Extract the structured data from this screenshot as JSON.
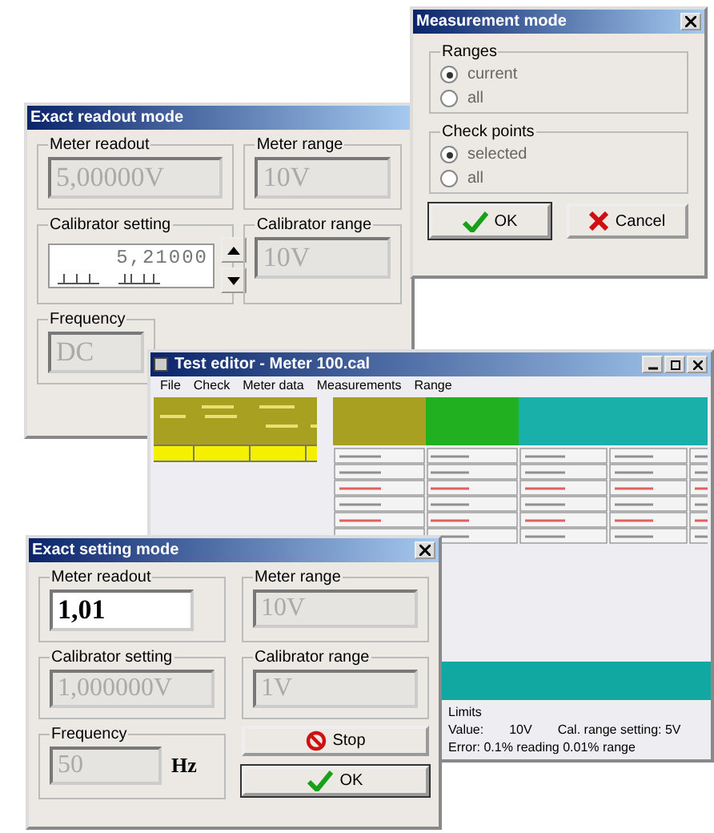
{
  "readout_dialog": {
    "title": "Exact readout mode",
    "meter_readout": {
      "label": "Meter readout",
      "value": "5,00000V"
    },
    "meter_range": {
      "label": "Meter range",
      "value": "10V"
    },
    "calibrator_setting": {
      "label": "Calibrator setting",
      "value": "5,21000"
    },
    "calibrator_range": {
      "label": "Calibrator range",
      "value": "10V"
    },
    "frequency": {
      "label": "Frequency",
      "value": "DC"
    }
  },
  "editor_window": {
    "title": "Test editor - Meter 100.cal",
    "menu": [
      "File",
      "Check",
      "Meter data",
      "Measurements",
      "Range"
    ],
    "status": {
      "heading": "Limits",
      "value_label": "Value:",
      "value": "10V",
      "range_setting": "Cal. range setting: 5V",
      "error": "Error: 0.1% reading  0.01% range"
    }
  },
  "measurement_dialog": {
    "title": "Measurement mode",
    "groups": [
      {
        "label": "Ranges",
        "options": [
          {
            "label": "current",
            "selected": true
          },
          {
            "label": "all",
            "selected": false
          }
        ]
      },
      {
        "label": "Check points",
        "options": [
          {
            "label": "selected",
            "selected": true
          },
          {
            "label": "all",
            "selected": false
          }
        ]
      }
    ],
    "ok": "OK",
    "cancel": "Cancel"
  },
  "setting_dialog": {
    "title": "Exact setting mode",
    "meter_readout": {
      "label": "Meter readout",
      "value": "1,01"
    },
    "meter_range": {
      "label": "Meter range",
      "value": "10V"
    },
    "calibrator_setting": {
      "label": "Calibrator setting",
      "value": "1,000000V"
    },
    "calibrator_range": {
      "label": "Calibrator range",
      "value": "1V"
    },
    "frequency": {
      "label": "Frequency",
      "value": "50",
      "unit": "Hz"
    },
    "stop": "Stop",
    "ok": "OK"
  }
}
